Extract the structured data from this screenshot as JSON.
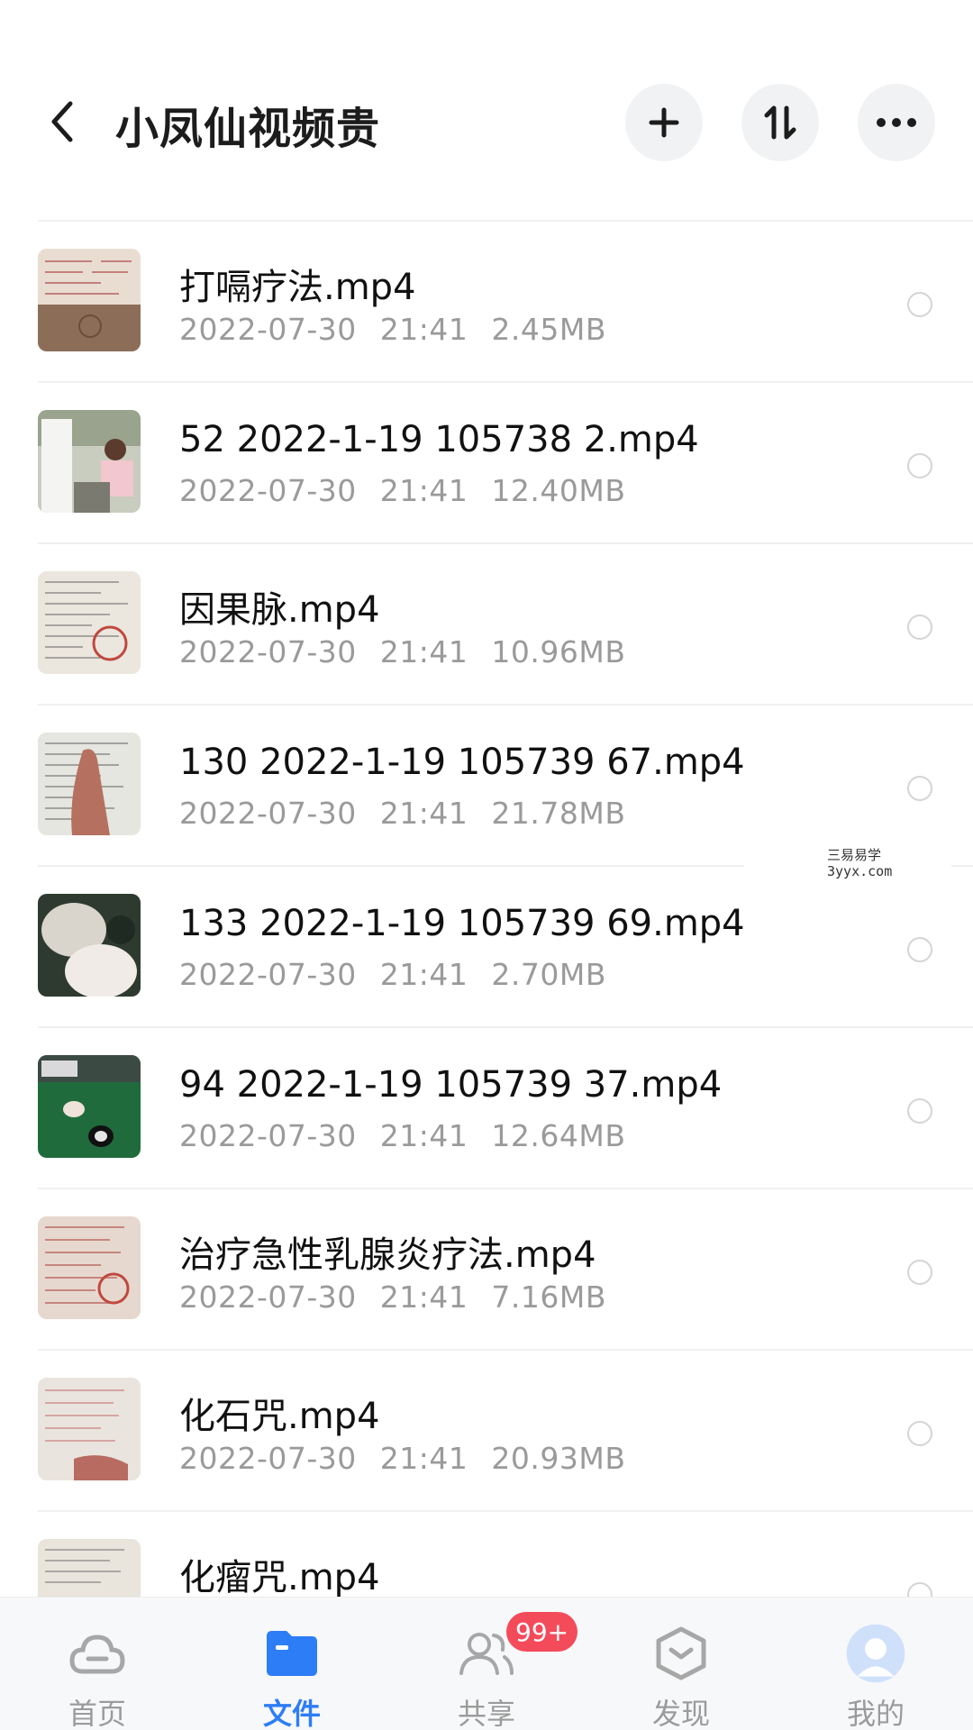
{
  "header": {
    "title": "小凤仙视频贵",
    "back_icon": "chevron-left-icon",
    "actions": [
      "plus-icon",
      "sort-icon",
      "more-icon"
    ]
  },
  "files": [
    {
      "name": "打嗝疗法.mp4",
      "date": "2022-07-30",
      "time": "21:41",
      "size": "2.45MB",
      "thumb": "notebook-stamp"
    },
    {
      "name": "52 2022-1-19 105738 2.mp4",
      "date": "2022-07-30",
      "time": "21:41",
      "size": "12.40MB",
      "thumb": "classroom"
    },
    {
      "name": "因果脉.mp4",
      "date": "2022-07-30",
      "time": "21:41",
      "size": "10.96MB",
      "thumb": "notebook-stamp"
    },
    {
      "name": "130 2022-1-19 105739 67.mp4",
      "date": "2022-07-30",
      "time": "21:41",
      "size": "21.78MB",
      "thumb": "notebook-hand"
    },
    {
      "name": "133 2022-1-19 105739 69.mp4",
      "date": "2022-07-30",
      "time": "21:41",
      "size": "2.70MB",
      "thumb": "dark-photo"
    },
    {
      "name": "94 2022-1-19 105739 37.mp4",
      "date": "2022-07-30",
      "time": "21:41",
      "size": "12.64MB",
      "thumb": "green-table"
    },
    {
      "name": "治疗急性乳腺炎疗法.mp4",
      "date": "2022-07-30",
      "time": "21:41",
      "size": "7.16MB",
      "thumb": "notebook-stamp"
    },
    {
      "name": "化石咒.mp4",
      "date": "2022-07-30",
      "time": "21:41",
      "size": "20.93MB",
      "thumb": "notebook-hand"
    },
    {
      "name": "化瘤咒.mp4",
      "date": "",
      "time": "",
      "size": "",
      "thumb": "notebook-stamp"
    }
  ],
  "watermark": {
    "line1": "三易易学",
    "line2": "3yyx.com"
  },
  "nav": [
    {
      "label": "首页",
      "icon": "cloud-icon",
      "active": false
    },
    {
      "label": "文件",
      "icon": "folder-icon",
      "active": true
    },
    {
      "label": "共享",
      "icon": "people-icon",
      "active": false,
      "badge": "99+"
    },
    {
      "label": "发现",
      "icon": "discover-icon",
      "active": false
    },
    {
      "label": "我的",
      "icon": "avatar-icon",
      "active": false
    }
  ],
  "colors": {
    "accent": "#2d7df6",
    "badge": "#f44b5b",
    "meta": "#9a9a9a"
  }
}
